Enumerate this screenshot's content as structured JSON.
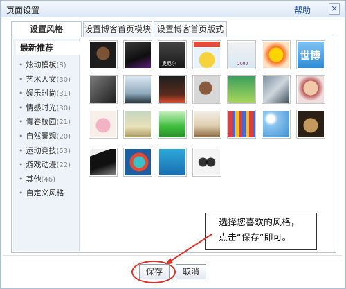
{
  "title": "页面设置",
  "help_label": "帮助",
  "close_glyph": "×",
  "tabs": [
    {
      "label": "设置风格"
    },
    {
      "label": "设置博客首页模块"
    },
    {
      "label": "设置博客首页版式"
    }
  ],
  "sidebar": {
    "heading": "最新推荐",
    "items": [
      {
        "label": "炫动模板",
        "count": "(8)"
      },
      {
        "label": "艺术人文",
        "count": "(30)"
      },
      {
        "label": "娱乐时尚",
        "count": "(31)"
      },
      {
        "label": "情感时光",
        "count": "(30)"
      },
      {
        "label": "青春校园",
        "count": "(21)"
      },
      {
        "label": "自然景观",
        "count": "(20)"
      },
      {
        "label": "运动竞技",
        "count": "(53)"
      },
      {
        "label": "游戏动漫",
        "count": "(22)"
      },
      {
        "label": "其他",
        "count": "(46)"
      },
      {
        "label": "自定义风格",
        "count": ""
      }
    ]
  },
  "thumb_labels": {
    "t3": "奥尼尔",
    "t5": "2009",
    "t7": "世博"
  },
  "buttons": {
    "save": "保存",
    "cancel": "取消"
  },
  "callout": {
    "line1": "选择您喜欢的风格，",
    "line2": "点击“保存”即可。"
  },
  "colors": {
    "accent_red": "#e0302a",
    "link_blue": "#1d4fa3",
    "sidebar_bg": "#eef3f9"
  }
}
